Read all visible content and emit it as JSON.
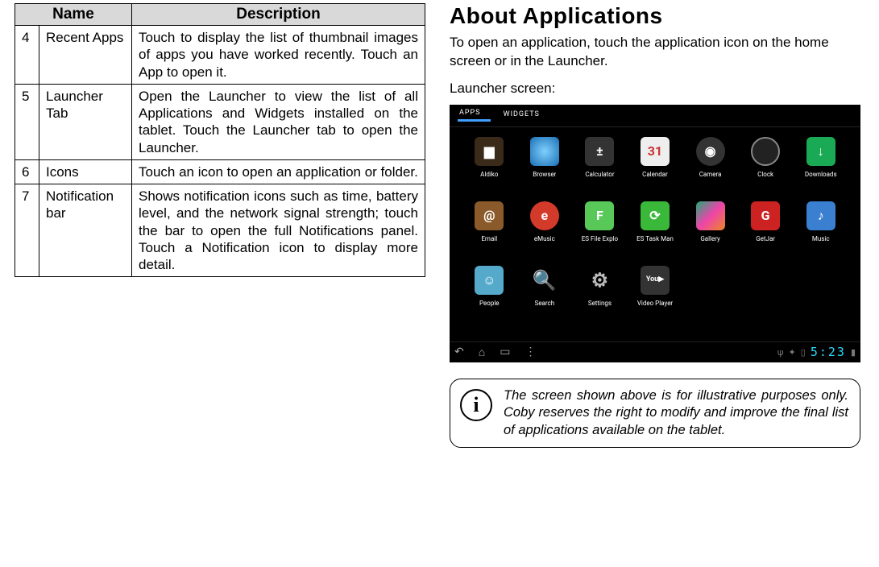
{
  "table": {
    "headers": {
      "name": "Name",
      "description": "Description"
    },
    "rows": [
      {
        "num": "4",
        "name": "Recent Apps",
        "desc": "Touch to display the list of thumbnail images of apps you have worked recently. Touch an App to open it."
      },
      {
        "num": "5",
        "name": "Launcher Tab",
        "desc": "Open the Launcher to view the list of all Applications and Widgets installed on the tablet. Touch the Launcher tab to open the Launcher."
      },
      {
        "num": "6",
        "name": "Icons",
        "desc": "Touch an icon to open an application or folder."
      },
      {
        "num": "7",
        "name": "Notification bar",
        "desc": "Shows notification icons such as time, battery level, and the network signal strength; touch the bar to open the full Notifications panel. Touch a Notification icon to display more detail."
      }
    ]
  },
  "right": {
    "heading": "About Applications",
    "intro": "To open an application, touch the application icon on the home screen or in the Launcher.",
    "launcher_label": "Launcher screen:"
  },
  "screenshot": {
    "tabs": {
      "apps": "APPS",
      "widgets": "WIDGETS"
    },
    "apps": [
      {
        "label": "Aldiko",
        "icon": "ic-aldiko",
        "glyph": "▆"
      },
      {
        "label": "Browser",
        "icon": "ic-browser",
        "glyph": ""
      },
      {
        "label": "Calculator",
        "icon": "ic-calc",
        "glyph": "±"
      },
      {
        "label": "Calendar",
        "icon": "ic-calendar",
        "glyph": "31"
      },
      {
        "label": "Camera",
        "icon": "ic-camera",
        "glyph": "◉"
      },
      {
        "label": "Clock",
        "icon": "ic-clock",
        "glyph": ""
      },
      {
        "label": "Downloads",
        "icon": "ic-downloads",
        "glyph": "↓"
      },
      {
        "label": "Email",
        "icon": "ic-email",
        "glyph": "@"
      },
      {
        "label": "eMusic",
        "icon": "ic-emusic",
        "glyph": "e"
      },
      {
        "label": "ES File Explo",
        "icon": "ic-esfile",
        "glyph": "F"
      },
      {
        "label": "ES Task Man",
        "icon": "ic-estask",
        "glyph": "⟳"
      },
      {
        "label": "Gallery",
        "icon": "ic-gallery",
        "glyph": ""
      },
      {
        "label": "GetJar",
        "icon": "ic-getjar",
        "glyph": "G"
      },
      {
        "label": "Music",
        "icon": "ic-music",
        "glyph": "♪"
      },
      {
        "label": "People",
        "icon": "ic-people",
        "glyph": "☺"
      },
      {
        "label": "Search",
        "icon": "ic-search",
        "glyph": "🔍"
      },
      {
        "label": "Settings",
        "icon": "ic-settings",
        "glyph": "⚙"
      },
      {
        "label": "Video Player",
        "icon": "ic-video",
        "glyph": "You▶"
      }
    ],
    "nav": {
      "back": "↶",
      "home": "⌂",
      "recent": "▭",
      "menu": "⋮",
      "time": "5:23"
    }
  },
  "callout": {
    "icon": "i",
    "text": "The screen shown above is for illustrative purposes only. Coby reserves the right to modify  and improve the final list of applications available on the tablet."
  }
}
